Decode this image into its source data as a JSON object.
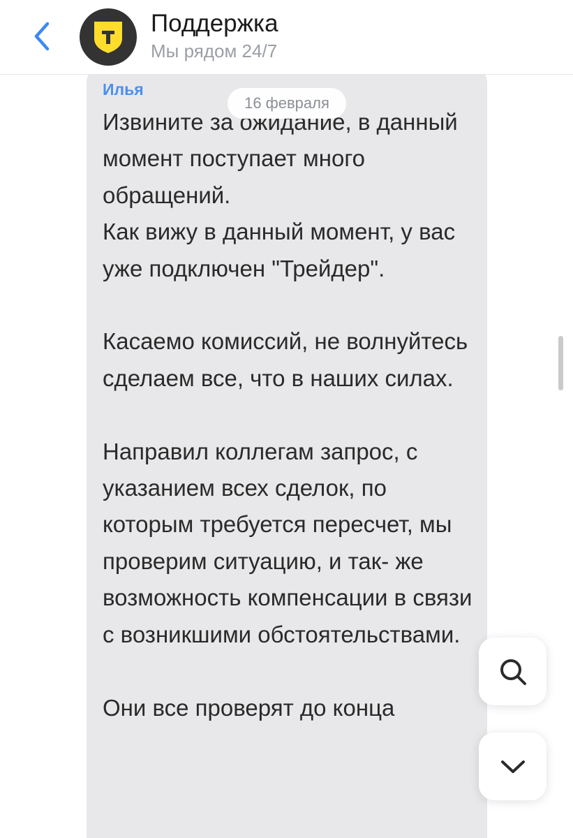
{
  "header": {
    "title": "Поддержка",
    "subtitle": "Мы рядом 24/7",
    "avatar_letter": "T",
    "brand_color": "#FFDD2D"
  },
  "chat": {
    "date_chip": "16 февраля",
    "message": {
      "sender": "Илья",
      "paragraphs": [
        "Извините за ожидание, в данный момент поступает много обращений.",
        "Как вижу в данный момент, у вас уже подключен \"Трейдер\".",
        "Касаемо комиссий, не волнуйтесь сделаем все, что в наших силах.",
        "Направил коллегам запрос, с указанием всех сделок, по которым требуется пересчет, мы проверим ситуацию, и так- же возможность компенсации в связи с возникшими обстоятельствами.",
        "Они все проверят до конца"
      ]
    }
  },
  "icons": {
    "back": "chevron-left-icon",
    "search": "search-icon",
    "scroll_down": "chevron-down-icon"
  },
  "colors": {
    "accent": "#4B8FF0",
    "bubble": "#E8E8EA"
  }
}
